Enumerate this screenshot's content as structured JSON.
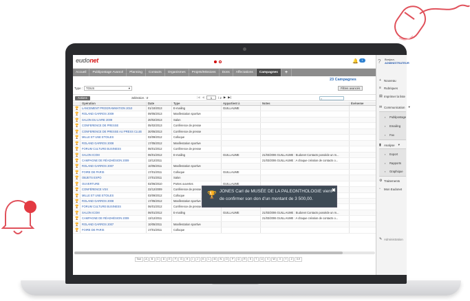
{
  "app": {
    "logo_main": "eudo",
    "logo_accent": "net",
    "notification_count": "1"
  },
  "nav": {
    "tabs": [
      "Accueil",
      "Publipostage Avancé",
      "Planning",
      "Contacts",
      "Organismes",
      "Projets/Missions",
      "Dons",
      "Affectations",
      "Campagnes"
    ],
    "active_index": 8,
    "add_label": "+"
  },
  "header": {
    "count_label": "23 Campagnes",
    "type_label": "Type :",
    "type_value": "TOUS",
    "filters_label": "Filtres avancés",
    "actions_label": "Actions",
    "selection_label": "Sélection : 0",
    "page_value": "1",
    "page_total": "/ 2"
  },
  "table": {
    "columns": [
      "Opération",
      "Date",
      "Type",
      "Appartient à",
      "Notes",
      "Événeme"
    ],
    "rows": [
      [
        "LANCEMENT PROGRAMMATION 2010",
        "01/10/2013",
        "E-mailing",
        "GUILLAUME",
        "",
        ""
      ],
      [
        "ROLAND GARROS 2009",
        "09/05/2013",
        "Manifestation sportive",
        "",
        "",
        ""
      ],
      [
        "SALON DU LIVRE 2009",
        "20/02/2013",
        "Salon",
        "",
        "",
        ""
      ],
      [
        "CONFERENCE DE PRESSE",
        "05/02/2013",
        "Conférence de presse",
        "",
        "",
        ""
      ],
      [
        "CONFERENCE DE PRESSE AU PRESS CLUB",
        "30/05/2013",
        "Conférence de presse",
        "",
        "",
        ""
      ],
      [
        "MILLE ET UNE ETOILES",
        "03/09/2012",
        "Colloque",
        "",
        "",
        ""
      ],
      [
        "ROLAND GARROS 2008",
        "17/05/2012",
        "Manifestation sportive",
        "",
        "",
        ""
      ],
      [
        "FORUM CULTURE BUSINESS",
        "06/01/2012",
        "Conférence de presse",
        "",
        "",
        ""
      ],
      [
        "SALON ICOM",
        "06/01/2012",
        "E-mailing",
        "GUILLAUME",
        "21/03/2006 GUILLAUME : Eudonet Contacts possède un m...",
        ""
      ],
      [
        "CAMPAGNE DE RÉADHÉSION 2009",
        "13/12/2011",
        "",
        "",
        "21/03/2006 GUILLAUME : A chaque création de contacts o...",
        ""
      ],
      [
        "ROLAND GARROS 2007",
        "10/05/2011",
        "Manifestation sportive",
        "",
        "",
        ""
      ],
      [
        "FOIRE DE PARIS",
        "17/01/2011",
        "Colloque",
        "GUILLAUME",
        "",
        ""
      ],
      [
        "OBJETS EXPO",
        "17/01/2011",
        "Salon",
        "",
        "",
        ""
      ],
      [
        "OUVERTURE",
        "03/06/2010",
        "Portes ouvertes",
        "GUILLAUME",
        "",
        ""
      ],
      [
        "CONFÉRENCE VSX",
        "22/12/2009",
        "Conférence de presse",
        "",
        "",
        ""
      ],
      [
        "MILLE ET UNE ETOILES",
        "03/09/2012",
        "Colloque",
        "",
        "",
        ""
      ],
      [
        "ROLAND GARROS 2008",
        "17/05/2012",
        "Manifestation sportive",
        "",
        "",
        ""
      ],
      [
        "FORUM CULTURE BUSINESS",
        "06/01/2012",
        "Conférence de presse",
        "",
        "",
        ""
      ],
      [
        "SALON ICOM",
        "06/01/2012",
        "E-mailing",
        "GUILLAUME",
        "21/03/2006 GUILLAUME : Eudonet Contacts possède un m...",
        ""
      ],
      [
        "CAMPAGNE DE RÉADHÉSION 2009",
        "13/12/2011",
        "",
        "",
        "21/03/2006 GUILLAUME : A chaque création de contacts o...",
        ""
      ],
      [
        "ROLAND GARROS 2007",
        "10/05/2011",
        "Manifestation sportive",
        "",
        "",
        ""
      ],
      [
        "FOIRE DE PARIS",
        "17/01/2011",
        "Colloque",
        "",
        "",
        ""
      ]
    ]
  },
  "alphabet": [
    "Tout",
    "A",
    "B",
    "C",
    "D",
    "E",
    "F",
    "G",
    "H",
    "I",
    "J",
    "K",
    "L",
    "M",
    "N",
    "O",
    "P",
    "Q",
    "R",
    "S",
    "T",
    "U",
    "V",
    "W",
    "X",
    "Y",
    "Z",
    "0-9"
  ],
  "user": {
    "greeting": "Bonjour,",
    "name": "ADMINISTRATEUR"
  },
  "menu": {
    "nouveau": "Nouveau",
    "rubriques": "Rubriques",
    "imprimer": "Imprimer la liste",
    "communication": "Communication",
    "publipostage": "Publipostage",
    "emailing": "Emailing",
    "fax": "Fax",
    "analyse": "Analyse",
    "export": "Export",
    "rapports": "Rapports",
    "graphique": "Graphique",
    "traitements": "Traitements",
    "mon_eudonet": "Mon Eudonet",
    "administration": "Administration"
  },
  "notification": {
    "text_line1": "JONES Carl de MUSÉE DE LA PALEONTHOLOGIE vient",
    "text_line2": "de confirmer son don d'un montant de 3 500,00."
  },
  "colors": {
    "accent": "#d81e1e",
    "nav_bg": "#8c8c8c",
    "nav_active": "#4a4a4a",
    "link": "#2a5db0",
    "notif_bg": "#3e4a55"
  }
}
